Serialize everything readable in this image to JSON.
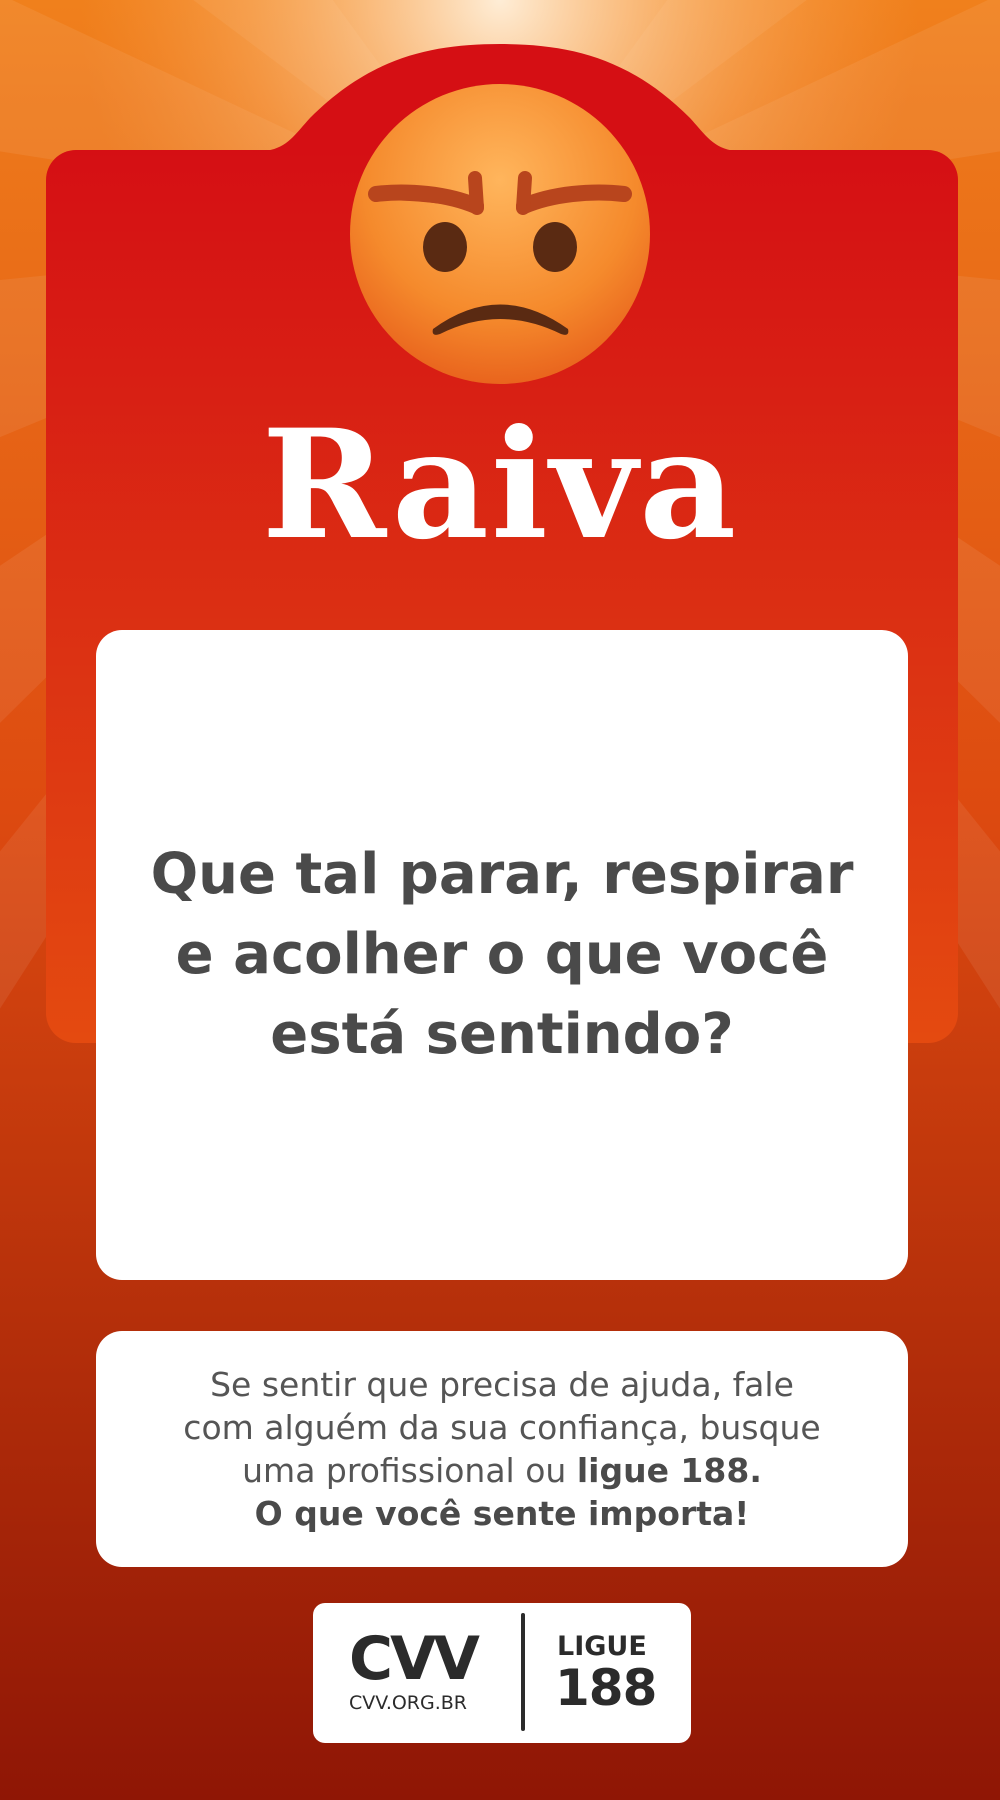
{
  "card": {
    "emotion_icon": "angry-face-icon",
    "title": "Raiva",
    "message": "Que tal parar, respirar e acolher o que você está sentindo?"
  },
  "help": {
    "line1": "Se sentir que precisa de ajuda, fale",
    "line2": "com alguém da sua confiança, busque",
    "line3_plain": "uma profissional ou ",
    "line3_bold": "ligue 188.",
    "line4_bold": "O que você sente importa!"
  },
  "logo": {
    "name": "CVV",
    "url": "CVV.ORG.BR",
    "call_label": "LIGUE",
    "call_number": "188"
  },
  "colors": {
    "card_red": "#d50f14",
    "card_orange": "#e44a10",
    "background_orange": "#ee7a1a",
    "background_dark_red": "#8f1605",
    "text_gray": "#4a4a4a"
  }
}
